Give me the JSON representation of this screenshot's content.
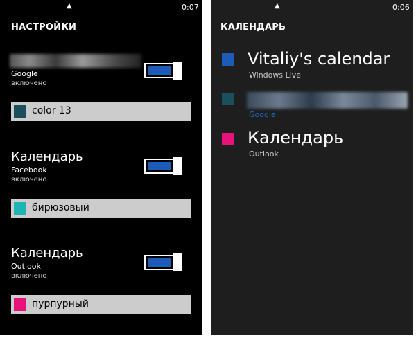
{
  "left_screen": {
    "status": {
      "time": "0:07",
      "arrow": "▲"
    },
    "page_title": "НАСТРОЙКИ",
    "accounts": [
      {
        "name": "",
        "provider": "Google",
        "status": "включено",
        "toggle_on": true,
        "color_name": "color 13",
        "color": "#1b4f5e"
      },
      {
        "name": "Календарь",
        "provider": "Facebook",
        "status": "включено",
        "toggle_on": true,
        "color_name": "бирюзовый",
        "color": "#1eb4b4"
      },
      {
        "name": "Календарь",
        "provider": "Outlook",
        "status": "включено",
        "toggle_on": true,
        "color_name": "пурпурный",
        "color": "#e8137a"
      }
    ]
  },
  "right_screen": {
    "status": {
      "time": "0:06",
      "arrow": "▲"
    },
    "page_title": "КАЛЕНДАРЬ",
    "calendars": [
      {
        "name": "Vitaliy's calendar",
        "source": "Windows Live",
        "color": "#1c5bb8"
      },
      {
        "name": "",
        "source": "Google",
        "color": "#1b4f5e"
      },
      {
        "name": "Календарь",
        "source": "Outlook",
        "color": "#e8137a"
      }
    ]
  },
  "colors": {
    "accent_blue": "#1c5bb8",
    "left_bg": "#000000",
    "right_bg": "#1e1e1e",
    "picker_bg": "#cccccc"
  }
}
